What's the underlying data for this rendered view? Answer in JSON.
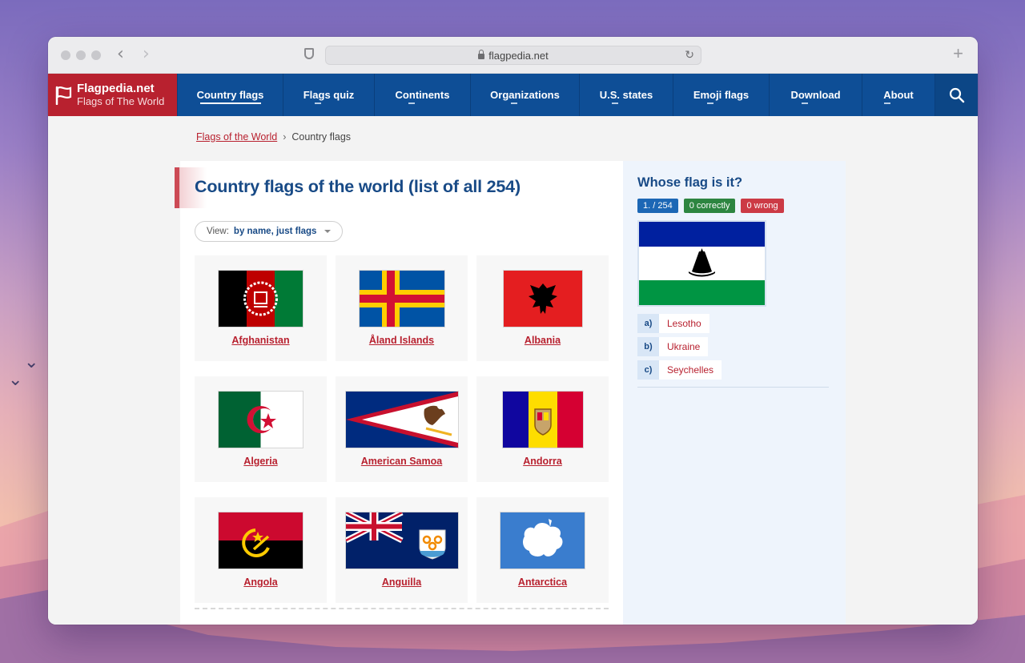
{
  "browser": {
    "url": "flagpedia.net"
  },
  "site": {
    "logo_title": "Flagpedia.net",
    "logo_subtitle": "Flags of The World",
    "nav": [
      {
        "label": "Country flags",
        "active": true
      },
      {
        "label": "Flags quiz",
        "active": false
      },
      {
        "label": "Continents",
        "active": false
      },
      {
        "label": "Organizations",
        "active": false
      },
      {
        "label": "U.S. states",
        "active": false
      },
      {
        "label": "Emoji flags",
        "active": false
      },
      {
        "label": "Download",
        "active": false
      },
      {
        "label": "About",
        "active": false
      }
    ],
    "colors": {
      "brand_red": "#b8212f",
      "nav_blue": "#0e4e96",
      "heading_blue": "#184a86"
    }
  },
  "breadcrumb": {
    "root": "Flags of the World",
    "separator": "›",
    "current": "Country flags"
  },
  "main": {
    "title": "Country flags of the world (list of all 254)",
    "view_label": "View:",
    "view_value": "by name, just flags",
    "countries": [
      {
        "name": "Afghanistan"
      },
      {
        "name": "Åland Islands"
      },
      {
        "name": "Albania"
      },
      {
        "name": "Algeria"
      },
      {
        "name": "American Samoa"
      },
      {
        "name": "Andorra"
      },
      {
        "name": "Angola"
      },
      {
        "name": "Anguilla"
      },
      {
        "name": "Antarctica"
      }
    ]
  },
  "quiz": {
    "title": "Whose flag is it?",
    "progress": "1. / 254",
    "correct": "0 correctly",
    "wrong": "0 wrong",
    "answers": [
      {
        "key": "a)",
        "label": "Lesotho"
      },
      {
        "key": "b)",
        "label": "Ukraine"
      },
      {
        "key": "c)",
        "label": "Seychelles"
      }
    ]
  }
}
